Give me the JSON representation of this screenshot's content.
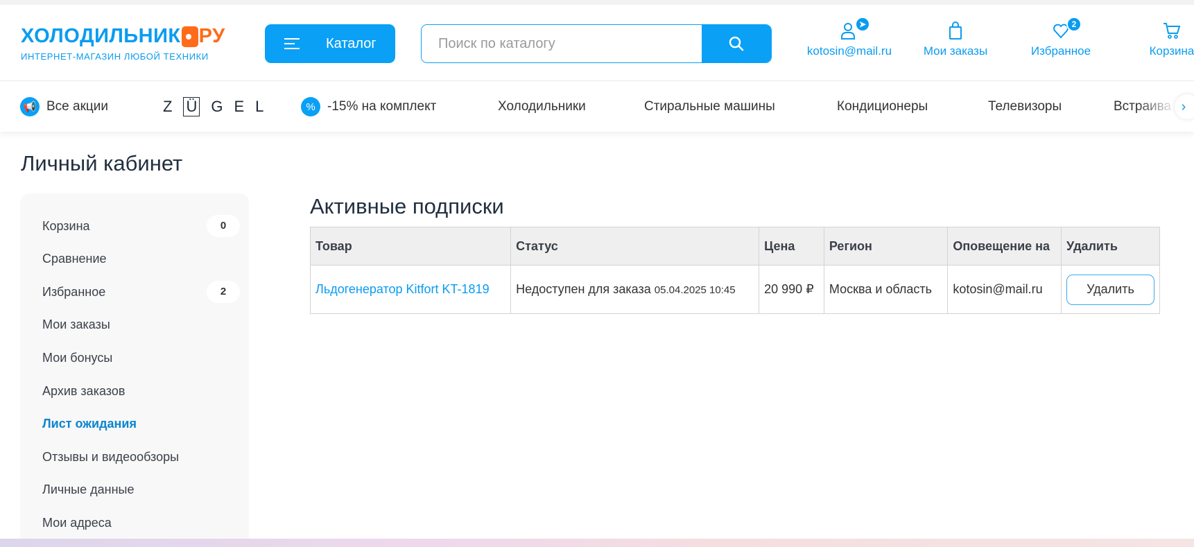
{
  "header": {
    "logo_main": "ХОЛОДИЛЬНИК",
    "logo_ru": "РУ",
    "logo_sub": "ИНТЕРНЕТ-МАГАЗИН ЛЮБОЙ ТЕХНИКИ",
    "catalog_label": "Каталог",
    "search_placeholder": "Поиск по каталогу",
    "account_label": "kotosin@mail.ru",
    "orders_label": "Мои заказы",
    "favorites_label": "Избранное",
    "favorites_badge": "2",
    "cart_label": "Корзина"
  },
  "nav": {
    "promo": "Все акции",
    "brand_z": "Z",
    "brand_u": "Ü",
    "brand_rest": "GEL",
    "discount": "-15% на комплект",
    "items": [
      "Холодильники",
      "Стиральные машины",
      "Кондиционеры",
      "Телевизоры",
      "Встраива"
    ]
  },
  "page_title": "Личный кабинет",
  "sidebar": {
    "items": [
      {
        "label": "Корзина",
        "count": "0"
      },
      {
        "label": "Сравнение"
      },
      {
        "label": "Избранное",
        "count": "2"
      },
      {
        "label": "Мои заказы"
      },
      {
        "label": "Мои бонусы"
      },
      {
        "label": "Архив заказов"
      },
      {
        "label": "Лист ожидания",
        "active": true
      },
      {
        "label": "Отзывы и видеообзоры"
      },
      {
        "label": "Личные данные"
      },
      {
        "label": "Мои адреса"
      }
    ]
  },
  "subscriptions": {
    "title": "Активные подписки",
    "columns": [
      "Товар",
      "Статус",
      "Цена",
      "Регион",
      "Оповещение на",
      "Удалить"
    ],
    "rows": [
      {
        "product": "Льдогенератор Kitfort KT-1819",
        "status": "Недоступен для заказа",
        "date": "05.04.2025 10:45",
        "price": "20 990 ₽",
        "region": "Москва и область",
        "notify": "kotosin@mail.ru",
        "delete_label": "Удалить"
      }
    ]
  },
  "colors": {
    "accent": "#0aa0f5",
    "brand_orange": "#ff6b1a"
  }
}
